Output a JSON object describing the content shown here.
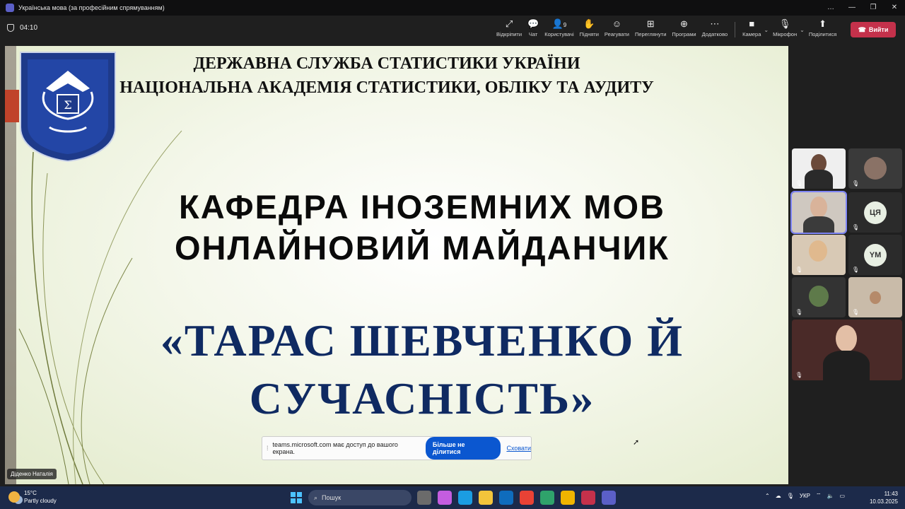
{
  "window": {
    "title": "Українська мова (за професійним спрямуванням)",
    "controls": [
      "…",
      "—",
      "❐",
      "✕"
    ]
  },
  "meeting": {
    "timer": "04:10",
    "toolbar": [
      {
        "icon": "pop-out-icon",
        "glyph": "⤢",
        "label": "Відкріпити"
      },
      {
        "icon": "chat-icon",
        "glyph": "💬",
        "label": "Чат"
      },
      {
        "icon": "people-icon",
        "glyph": "👤",
        "label": "Користувачі",
        "count": "9"
      },
      {
        "icon": "raise-hand-icon",
        "glyph": "✋",
        "label": "Підняти"
      },
      {
        "icon": "react-icon",
        "glyph": "☺",
        "label": "Реагувати"
      },
      {
        "icon": "view-icon",
        "glyph": "⊞",
        "label": "Переглянути"
      },
      {
        "icon": "apps-icon",
        "glyph": "⊕",
        "label": "Програми"
      },
      {
        "icon": "more-icon",
        "glyph": "⋯",
        "label": "Додатково"
      }
    ],
    "camera_label": "Камера",
    "mic_label": "Мікрофон",
    "share_label": "Поділитися",
    "leave_label": "Вийти"
  },
  "slide": {
    "institution_line1": "ДЕРЖАВНА СЛУЖБА СТАТИСТИКИ УКРАЇНИ",
    "institution_line2": "НАЦІОНАЛЬНА АКАДЕМІЯ СТАТИСТИКИ, ОБЛІКУ ТА АУДИТУ",
    "logo_text": "НАЦІОНАЛЬНА АКАДЕМІЯ СТАТИСТИКИ, ОБЛІКУ ТА АУДИТУ",
    "department_line1": "КАФЕДРА ІНОЗЕМНИХ МОВ",
    "department_line2": "ОНЛАЙНОВИЙ МАЙДАНЧИК",
    "topic_line1": "«ТАРАС ШЕВЧЕНКО Й",
    "topic_line2": "СУЧАСНІСТЬ»",
    "presenter": "Діденко Наталія"
  },
  "share_bar": {
    "message": "teams.microsoft.com має доступ до вашого екрана.",
    "stop_label": "Більше не ділитися",
    "hide_label": "Сховати"
  },
  "participants": [
    {
      "type": "video"
    },
    {
      "type": "video"
    },
    {
      "type": "video",
      "active": true
    },
    {
      "type": "initials",
      "initials": "ЦЯ"
    },
    {
      "type": "video"
    },
    {
      "type": "initials",
      "initials": "YM"
    },
    {
      "type": "video"
    },
    {
      "type": "video"
    },
    {
      "type": "video"
    }
  ],
  "taskbar": {
    "temperature": "15°C",
    "weather": "Partly cloudy",
    "search_placeholder": "Пошук",
    "language": "УКР",
    "time": "11:43",
    "date": "10.03.2025"
  },
  "colors": {
    "leave": "#c4314b",
    "topic": "#0f2a62",
    "stop_share": "#0b57d0"
  }
}
